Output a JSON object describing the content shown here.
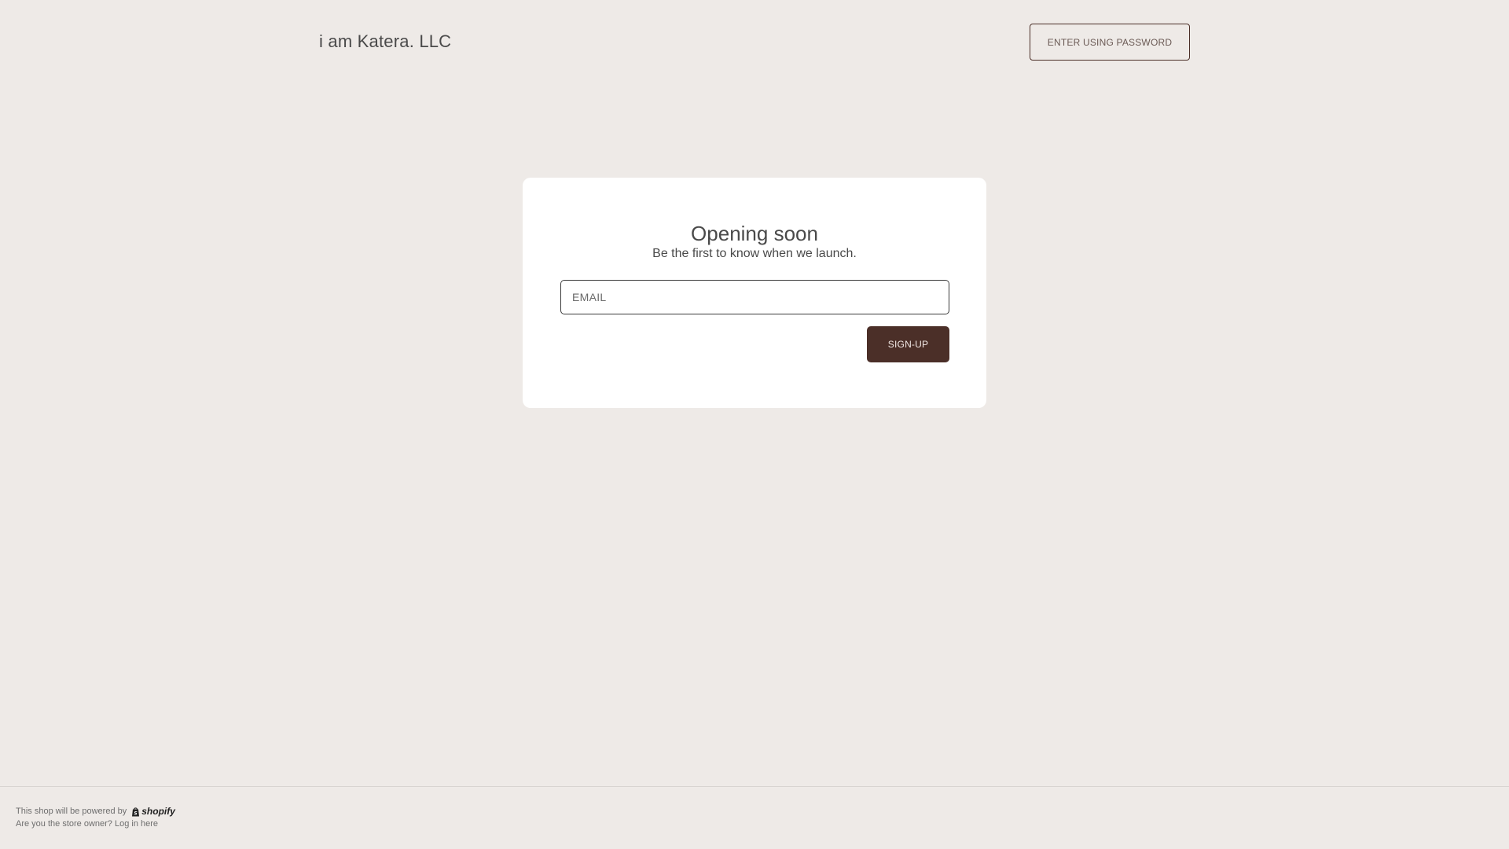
{
  "header": {
    "store_name": "i am Katera. LLC",
    "enter_password_label": "ENTER USING PASSWORD"
  },
  "card": {
    "title": "Opening soon",
    "subtitle": "Be the first to know when we launch.",
    "email_placeholder": "EMAIL",
    "email_value": "",
    "signup_label": "SIGN-UP"
  },
  "footer": {
    "powered_by_text": "This shop will be powered by",
    "shopify_logo_text": "shopify",
    "owner_question": "Are you the store owner?",
    "login_link": "Log in here"
  },
  "colors": {
    "background": "#eeeae7",
    "card": "#ffffff",
    "accent": "#4b2f28"
  },
  "icons": {
    "shopify_logo": "shopify-bag-icon"
  }
}
